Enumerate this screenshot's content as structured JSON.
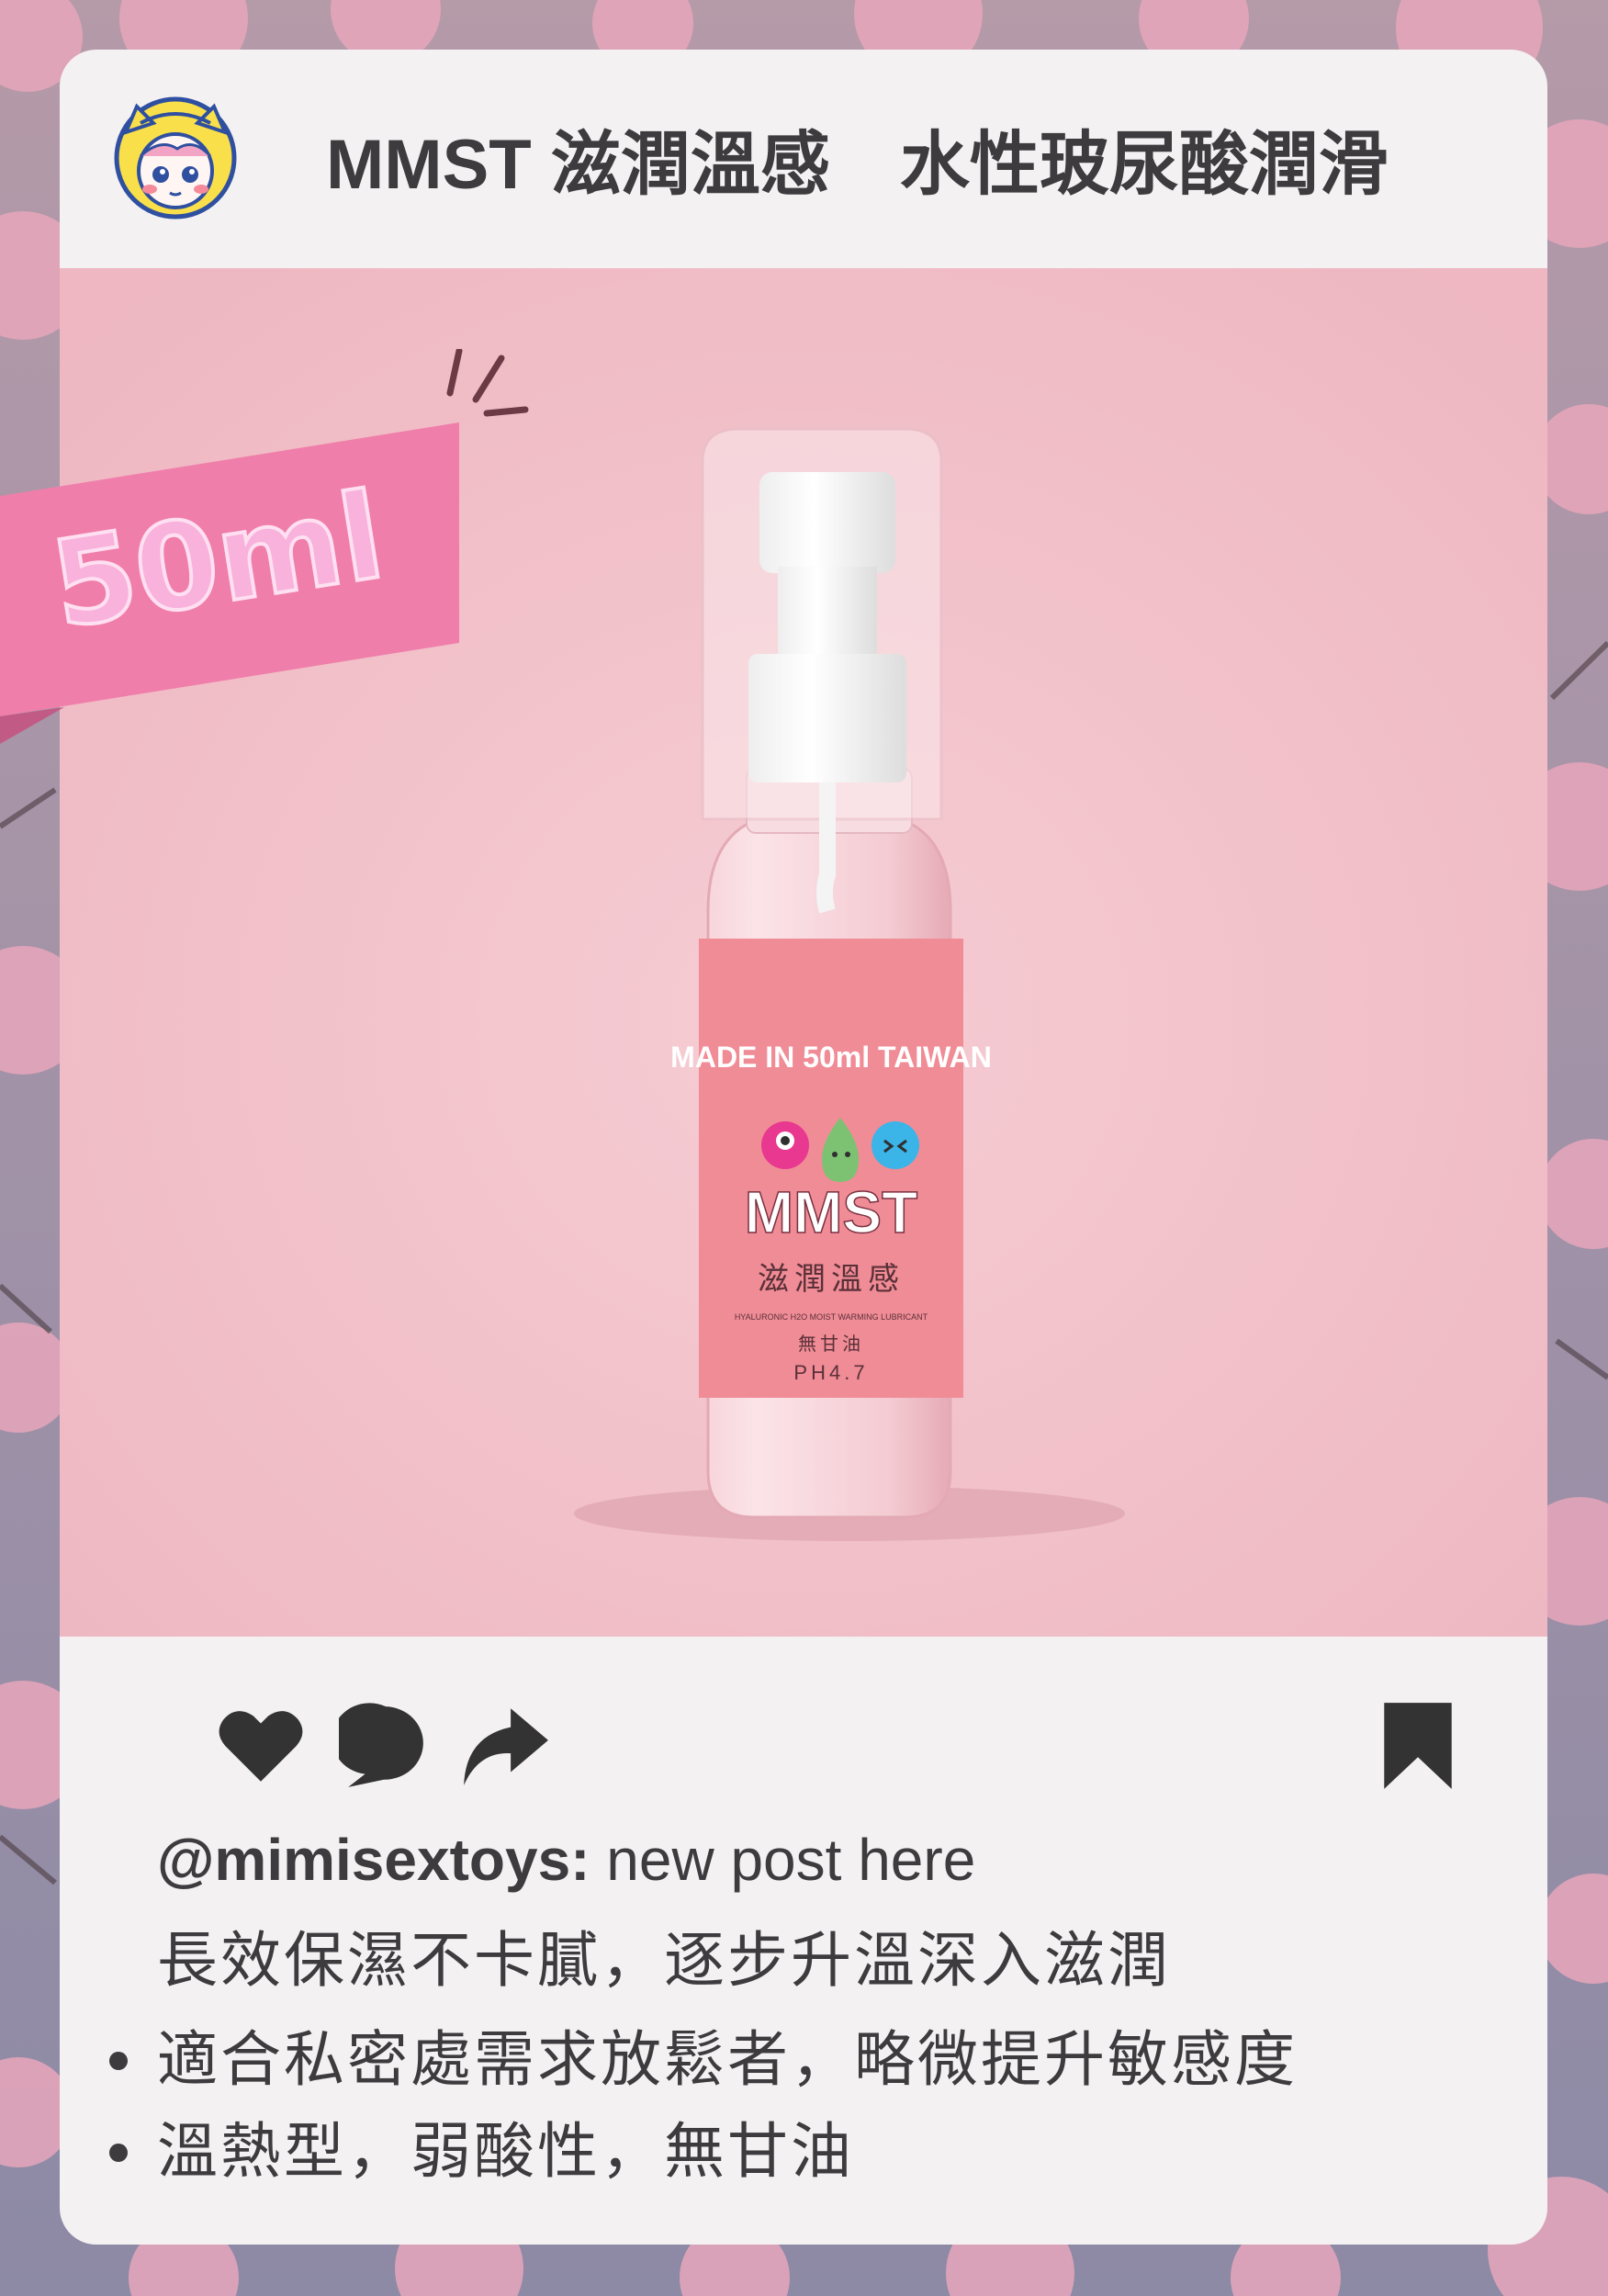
{
  "post": {
    "title": "MMST 滋潤溫感　水性玻尿酸潤滑",
    "volume_tag": "50ml",
    "username": "@mimisextoys:",
    "caption_text": " new post here",
    "description": "長效保濕不卡膩，逐步升溫深入滋潤",
    "bullets": [
      "適合私密處需求放鬆者，略微提升敏感度",
      "溫熱型，弱酸性，無甘油"
    ]
  },
  "product_label": {
    "arc_text": "MADE IN 50ml TAIWAN",
    "brand": "MMST",
    "name_cn": "滋潤溫感",
    "sub_text": "HYALURONIC H2O MOIST WARMING LUBRICANT",
    "glycerin": "無甘油",
    "ph": "PH4.7"
  },
  "icons": {
    "avatar": "tiger-hood-avatar-icon",
    "like": "heart-icon",
    "comment": "comment-bubble-icon",
    "share": "share-arrow-icon",
    "save": "bookmark-icon"
  },
  "colors": {
    "card": "#f3f1f2",
    "photo_bg": "#f3c5cd",
    "ribbon": "#f07eaa",
    "text": "#3d3b3d",
    "label": "#f08c96"
  }
}
